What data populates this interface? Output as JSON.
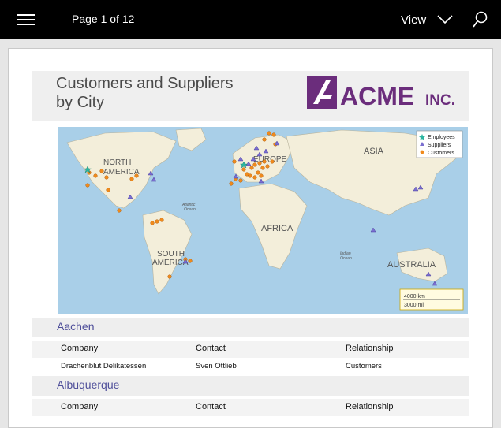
{
  "toolbar": {
    "page_indicator": "Page 1 of 12",
    "view_label": "View",
    "menu_icon": "hamburger-menu-icon",
    "view_icon": "chevron-down-icon",
    "search_icon": "search-icon"
  },
  "report": {
    "title_line1": "Customers and Suppliers",
    "title_line2": "by City",
    "logo_text": "ACME",
    "logo_suffix": "INC.",
    "brand_color": "#6b2d7c"
  },
  "map": {
    "continent_labels": [
      "NORTH",
      "AMERICA",
      "EUROPE",
      "ASIA",
      "AFRICA",
      "SOUTH",
      "AMERICA",
      "AUSTRALIA"
    ],
    "ocean_labels": [
      "Atlantic",
      "Ocean",
      "Indian",
      "Ocean"
    ],
    "legend": [
      "Employees",
      "Suppliers",
      "Customers"
    ],
    "scale": [
      "4000 km",
      "3000 mi"
    ],
    "colors": {
      "employees": "#2bb5a0",
      "suppliers": "#7b6fd0",
      "customers": "#f08a1c"
    }
  },
  "groups": [
    {
      "city": "Aachen",
      "columns": [
        "Company",
        "Contact",
        "Relationship"
      ],
      "rows": [
        {
          "company": "Drachenblut Delikatessen",
          "contact": "Sven Ottlieb",
          "relationship": "Customers"
        }
      ]
    },
    {
      "city": "Albuquerque",
      "columns": [
        "Company",
        "Contact",
        "Relationship"
      ],
      "rows": []
    }
  ]
}
